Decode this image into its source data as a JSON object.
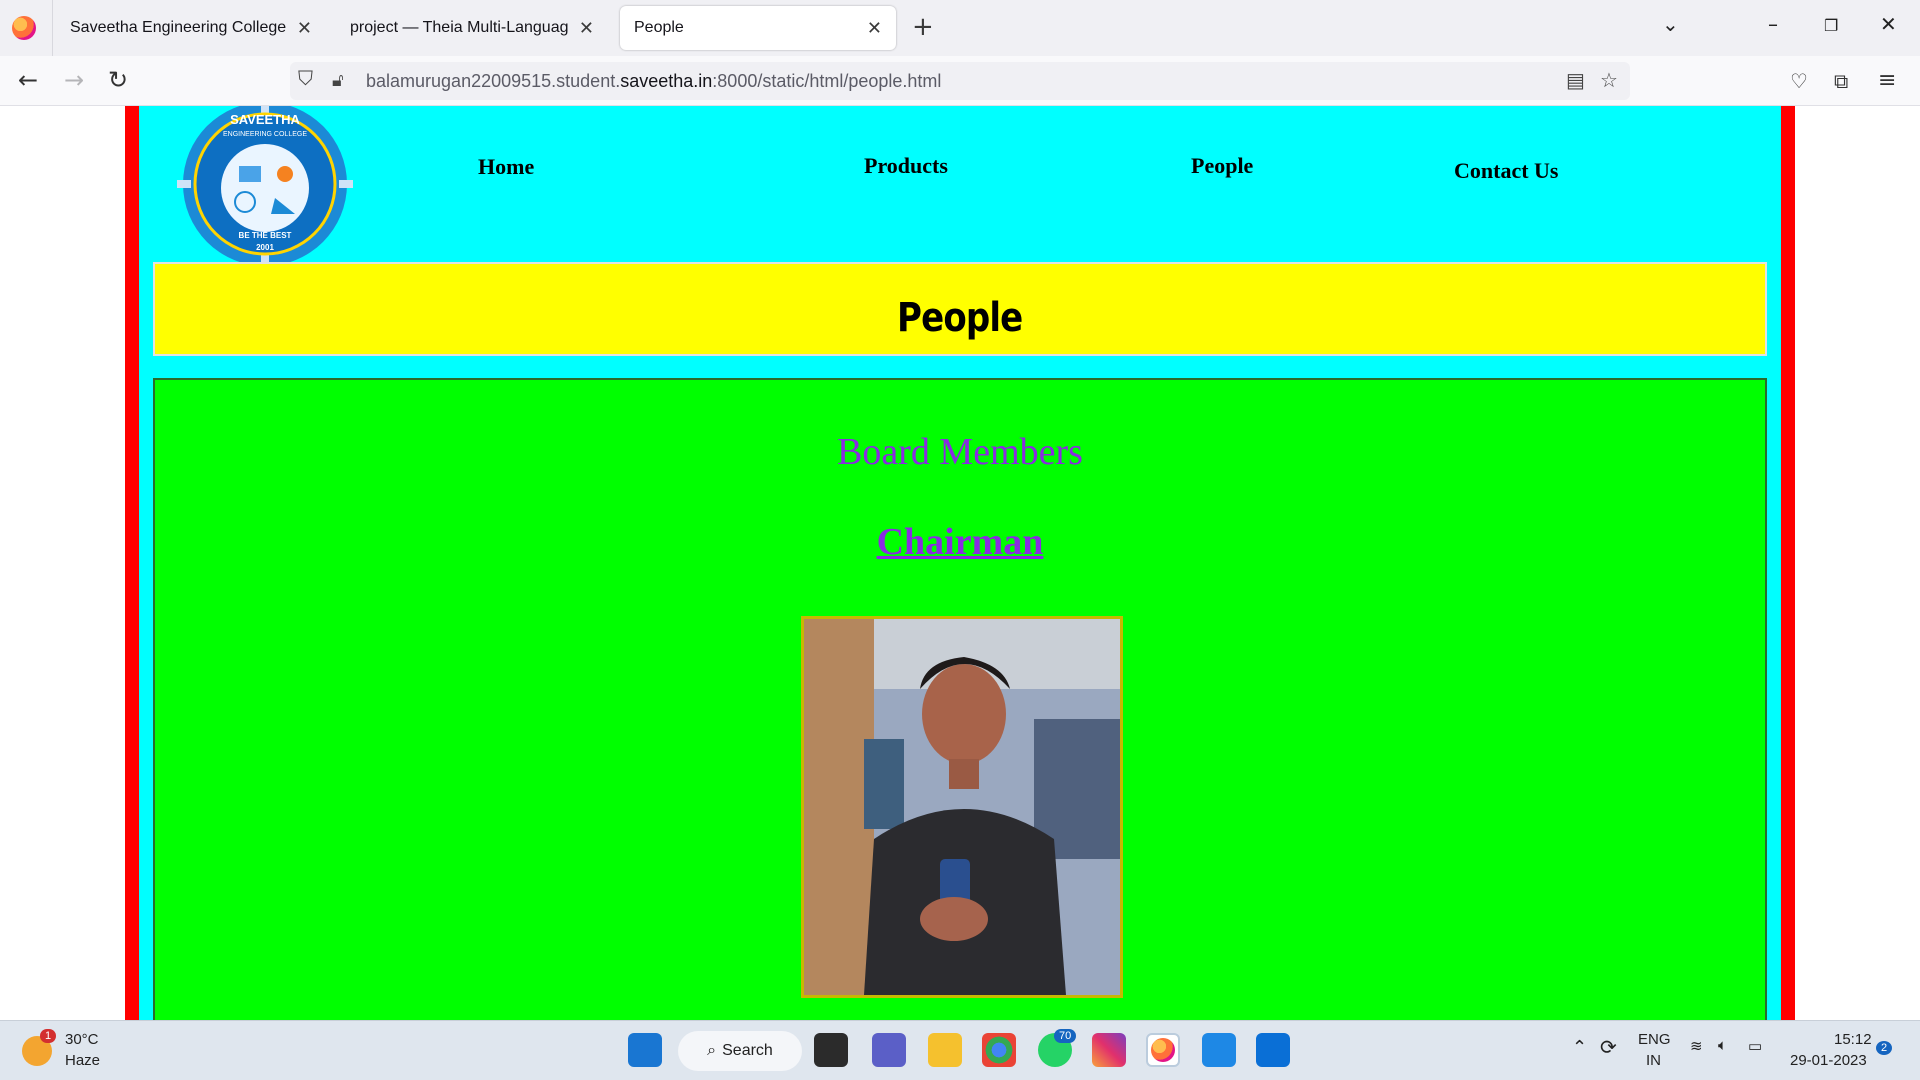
{
  "browser": {
    "tabs": [
      {
        "label": "Saveetha Engineering College",
        "active": false
      },
      {
        "label": "project — Theia Multi-Language Ex",
        "active": false
      },
      {
        "label": "People",
        "active": true
      }
    ],
    "url": {
      "prefix": "balamurugan22009515.student.",
      "domain": "saveetha.in",
      "suffix": ":8000/static/html/people.html"
    }
  },
  "site": {
    "logo": {
      "top_text": "SAVEETHA",
      "sub_text": "ENGINEERING COLLEGE",
      "motto": "BE THE BEST",
      "year": "2001"
    },
    "nav": [
      "Home",
      "Products",
      "People",
      "Contact Us"
    ],
    "page_title": "People",
    "section_heading": "Board Members",
    "role_link": "Chairman"
  },
  "taskbar": {
    "weather": {
      "temp": "30°C",
      "condition": "Haze",
      "alert_count": "1"
    },
    "search_label": "Search",
    "whatsapp_badge": "70",
    "lang": {
      "line1": "ENG",
      "line2": "IN"
    },
    "clock": {
      "time": "15:12",
      "date": "29-01-2023"
    },
    "notifications": "2"
  },
  "colors": {
    "frame_border": "#ff0000",
    "frame_bg": "#00ffff",
    "title_bg": "#ffff00",
    "content_bg": "#00ff00",
    "heading_color": "#8a2be2"
  }
}
